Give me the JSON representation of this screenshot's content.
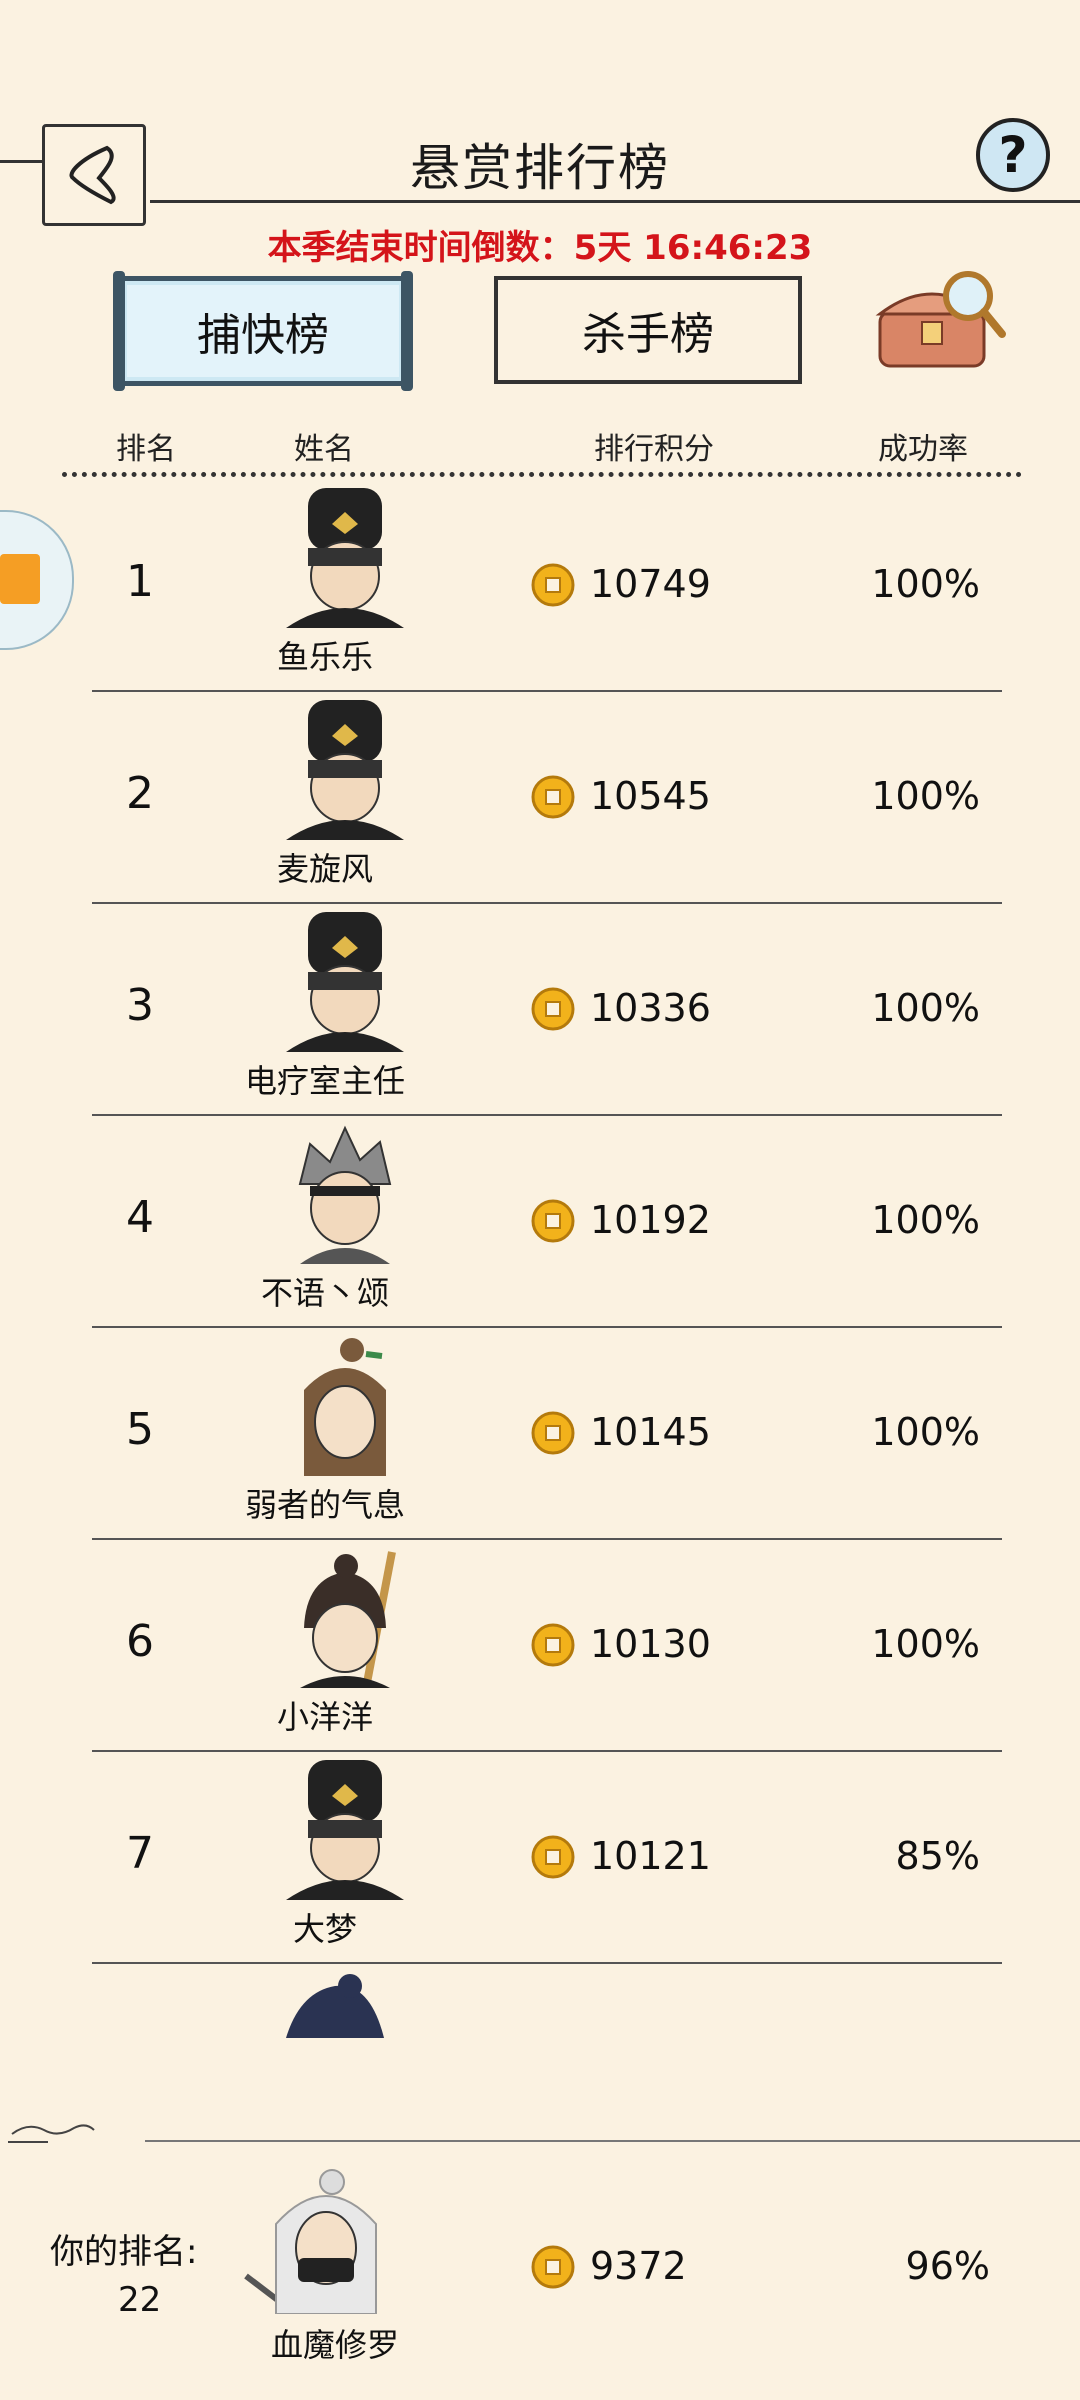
{
  "header": {
    "title": "悬赏排行榜",
    "help_label": "?"
  },
  "countdown": {
    "label": "本季结束时间倒数：",
    "value": "5天 16:46:23"
  },
  "tabs": [
    {
      "label": "捕快榜",
      "active": true
    },
    {
      "label": "杀手榜",
      "active": false
    }
  ],
  "columns": {
    "rank": "排名",
    "name": "姓名",
    "score": "排行积分",
    "rate": "成功率"
  },
  "rows": [
    {
      "rank": "1",
      "name": "鱼乐乐",
      "score": "10749",
      "rate": "100%"
    },
    {
      "rank": "2",
      "name": "麦旋风",
      "score": "10545",
      "rate": "100%"
    },
    {
      "rank": "3",
      "name": "电疗室主任",
      "score": "10336",
      "rate": "100%"
    },
    {
      "rank": "4",
      "name": "不语丶颂",
      "score": "10192",
      "rate": "100%"
    },
    {
      "rank": "5",
      "name": "弱者的气息",
      "score": "10145",
      "rate": "100%"
    },
    {
      "rank": "6",
      "name": "小洋洋",
      "score": "10130",
      "rate": "100%"
    },
    {
      "rank": "7",
      "name": "大梦",
      "score": "10121",
      "rate": "85%"
    }
  ],
  "you": {
    "label": "你的排名:",
    "rank": "22",
    "name": "血魔修罗",
    "score": "9372",
    "rate": "96%"
  },
  "colors": {
    "accent_red": "#d4141a",
    "background": "#fbf2e1",
    "tab_active_bg": "#e3f3fa",
    "coin": "#f2b21b"
  }
}
